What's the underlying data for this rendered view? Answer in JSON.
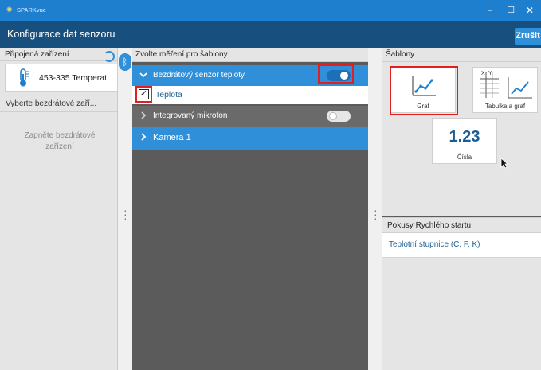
{
  "window": {
    "app_name": "SPARKvue",
    "minimize_glyph": "–",
    "maximize_glyph": "☐",
    "close_glyph": "✕"
  },
  "header": {
    "title": "Konfigurace dat senzoru",
    "cancel_label": "Zrušit"
  },
  "left_panel": {
    "connected_title": "Připojená zařízení",
    "device": {
      "name": "453-335 Temperat",
      "icon": "thermometer-icon"
    },
    "wireless_title": "Vyberte bezdrátové zaří...",
    "wireless_message": "Zapněte bezdrátové zařízení"
  },
  "middle_panel": {
    "title": "Zvolte měření pro šablony",
    "sensors": [
      {
        "label": "Bezdrátový senzor teploty",
        "expanded": true,
        "toggle_on": true
      },
      {
        "label": "Integrovaný mikrofon",
        "expanded": false,
        "toggle_on": false
      },
      {
        "label": "Kamera 1",
        "expanded": false
      }
    ],
    "measurement": {
      "label": "Teplota",
      "checked": true
    }
  },
  "right_panel": {
    "templates_title": "Šablony",
    "templates": [
      {
        "label": "Graf",
        "icon": "graph-icon",
        "selected": true
      },
      {
        "label": "Tabulka a graf",
        "icon": "table-graph-icon",
        "selected": false
      },
      {
        "label": "Čísla",
        "icon": "digits-icon",
        "value": "1.23",
        "selected": false
      }
    ],
    "table_icon_letters": {
      "x": "X",
      "y": "Y"
    },
    "quickstart_title": "Pokusy Rychlého startu",
    "quickstart_items": [
      "Teplotní stupnice (C, F, K)"
    ]
  },
  "colors": {
    "titlebar": "#1f7fcf",
    "header": "#174f7e",
    "accent": "#2f8fd8",
    "highlight": "#e02020",
    "panel_dark": "#5b5b5b",
    "panel_light": "#e5e5e5"
  }
}
